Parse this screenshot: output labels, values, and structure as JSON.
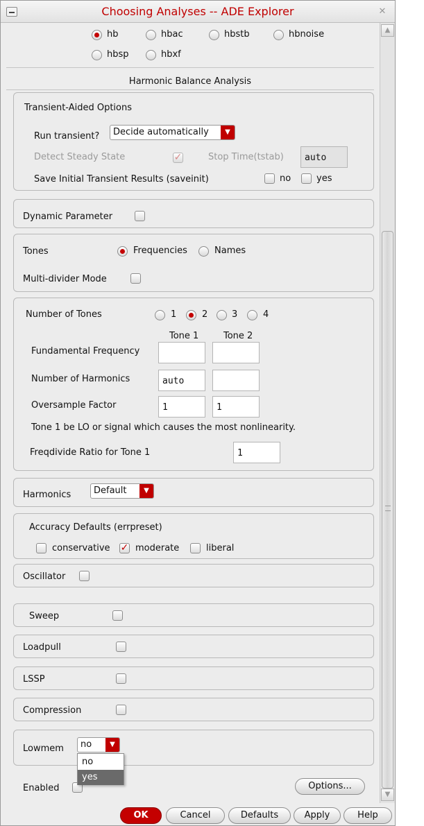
{
  "window": {
    "title": "Choosing Analyses -- ADE Explorer"
  },
  "analyses": [
    {
      "label": "hb",
      "selected": true
    },
    {
      "label": "hbac",
      "selected": false
    },
    {
      "label": "hbstb",
      "selected": false
    },
    {
      "label": "hbnoise",
      "selected": false
    },
    {
      "label": "hbsp",
      "selected": false
    },
    {
      "label": "hbxf",
      "selected": false
    }
  ],
  "section_title": "Harmonic Balance Analysis",
  "transient": {
    "group_title": "Transient-Aided Options",
    "run_label": "Run transient?",
    "run_value": "Decide automatically",
    "detect_label": "Detect Steady State",
    "detect_checked": true,
    "stop_label": "Stop Time(tstab)",
    "stop_value": "auto",
    "save_label": "Save Initial Transient Results (saveinit)",
    "no_label": "no",
    "yes_label": "yes"
  },
  "dynamic_parameter": {
    "label": "Dynamic Parameter"
  },
  "tones": {
    "label": "Tones",
    "frequencies_label": "Frequencies",
    "names_label": "Names",
    "selected": "Frequencies",
    "multi_divider_label": "Multi-divider Mode"
  },
  "tone_setup": {
    "num_tones_label": "Number of Tones",
    "tone_options": [
      "1",
      "2",
      "3",
      "4"
    ],
    "selected_tones": "2",
    "columns": [
      "Tone 1",
      "Tone 2"
    ],
    "rows": [
      {
        "label": "Fundamental Frequency",
        "values": [
          "",
          ""
        ]
      },
      {
        "label": "Number of Harmonics",
        "values": [
          "auto",
          ""
        ]
      },
      {
        "label": "Oversample Factor",
        "values": [
          "1",
          "1"
        ]
      }
    ],
    "note": "Tone 1 be LO or signal which causes the most nonlinearity.",
    "freqdivide_label": "Freqdivide Ratio for Tone 1",
    "freqdivide_value": "1"
  },
  "harmonics": {
    "label": "Harmonics",
    "value": "Default"
  },
  "accuracy": {
    "title": "Accuracy Defaults (errpreset)",
    "options": [
      {
        "label": "conservative",
        "checked": false
      },
      {
        "label": "moderate",
        "checked": true
      },
      {
        "label": "liberal",
        "checked": false
      }
    ]
  },
  "oscillator": {
    "label": "Oscillator"
  },
  "sweep": {
    "label": "Sweep"
  },
  "loadpull": {
    "label": "Loadpull"
  },
  "lssp": {
    "label": "LSSP"
  },
  "compression": {
    "label": "Compression"
  },
  "lowmem": {
    "label": "Lowmem",
    "value": "no",
    "options": [
      "no",
      "yes"
    ],
    "highlighted": "yes"
  },
  "enabled": {
    "label": "Enabled"
  },
  "options_button": "Options...",
  "buttons": {
    "ok": "OK",
    "cancel": "Cancel",
    "defaults": "Defaults",
    "apply": "Apply",
    "help": "Help"
  },
  "colors": {
    "accent": "#c40000",
    "title": "#c00000",
    "panel": "#ececec"
  }
}
